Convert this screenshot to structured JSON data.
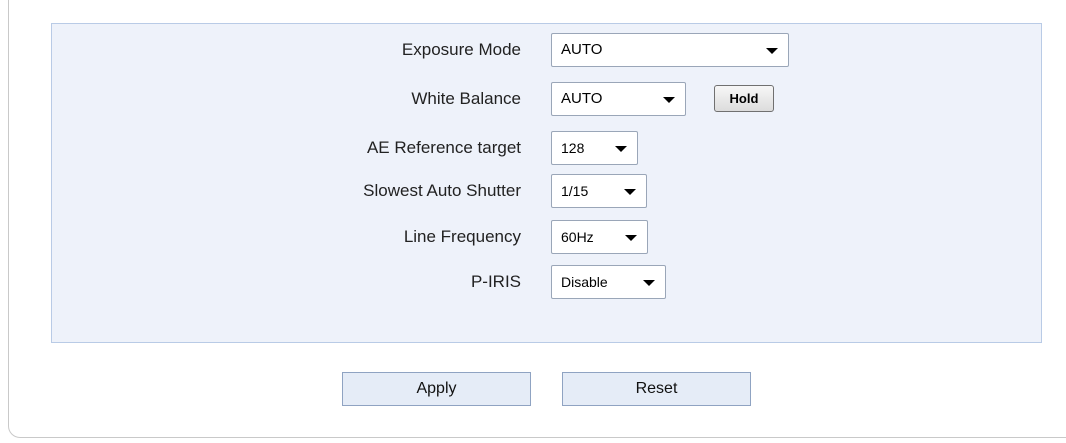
{
  "settings": {
    "exposure_mode": {
      "label": "Exposure Mode",
      "value": "AUTO"
    },
    "white_balance": {
      "label": "White Balance",
      "value": "AUTO",
      "hold_label": "Hold"
    },
    "ae_reference_target": {
      "label": "AE Reference target",
      "value": "128"
    },
    "slowest_auto_shutter": {
      "label": "Slowest Auto Shutter",
      "value": "1/15"
    },
    "line_frequency": {
      "label": "Line Frequency",
      "value": "60Hz"
    },
    "p_iris": {
      "label": "P-IRIS",
      "value": "Disable"
    }
  },
  "actions": {
    "apply_label": "Apply",
    "reset_label": "Reset"
  },
  "colors": {
    "panel_background": "#eef2fa",
    "panel_border": "#b9cbe6",
    "button_background": "#e5ecf7"
  }
}
